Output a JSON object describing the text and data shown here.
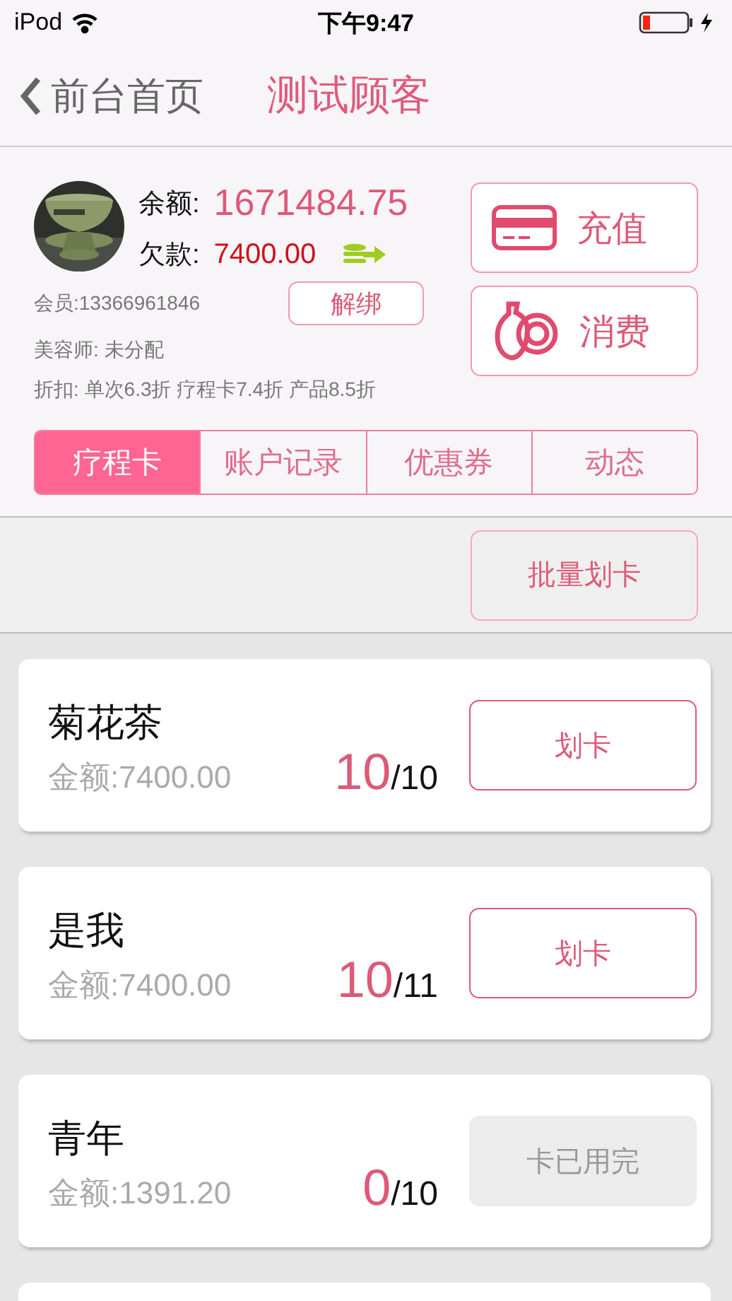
{
  "status_bar": {
    "carrier": "iPod",
    "time": "下午9:47"
  },
  "nav": {
    "back_label": "前台首页",
    "title": "测试顾客"
  },
  "profile": {
    "balance_label": "余额:",
    "balance": "1671484.75",
    "debt_label": "欠款:",
    "debt": "7400.00",
    "member": "会员:13366961846",
    "unbind_button": "解绑",
    "beautician": "美容师: 未分配",
    "discount": "折扣: 单次6.3折 疗程卡7.4折 产品8.5折"
  },
  "actions": [
    {
      "kind": "recharge",
      "label": "充值"
    },
    {
      "kind": "consume",
      "label": "消费"
    }
  ],
  "tabs": [
    {
      "label": "疗程卡",
      "selected": true
    },
    {
      "label": "账户记录",
      "selected": false
    },
    {
      "label": "优惠券",
      "selected": false
    },
    {
      "label": "动态",
      "selected": false
    }
  ],
  "batch_button": "批量划卡",
  "cards": [
    {
      "name": "菊花茶",
      "amount": "金额:7400.00",
      "remaining": "10",
      "total": "/10",
      "button": "划卡",
      "disabled": false
    },
    {
      "name": "是我",
      "amount": "金额:7400.00",
      "remaining": "10",
      "total": "/11",
      "button": "划卡",
      "disabled": false
    },
    {
      "name": "青年",
      "amount": "金额:1391.20",
      "remaining": "0",
      "total": "/10",
      "button": "卡已用完",
      "disabled": true
    }
  ]
}
